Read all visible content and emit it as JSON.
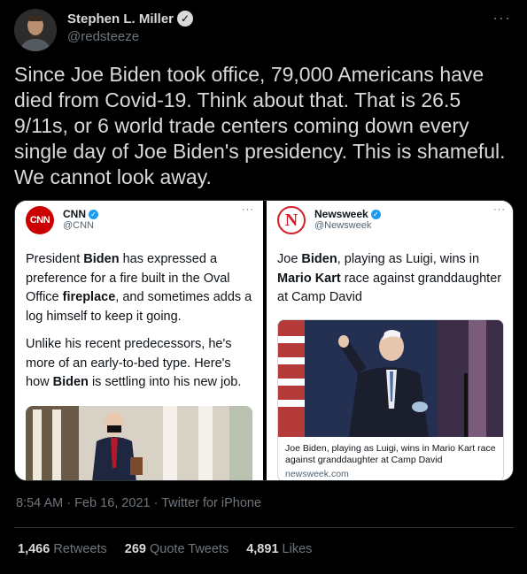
{
  "author": {
    "name": "Stephen L. Miller",
    "handle": "@redsteeze"
  },
  "tweet": {
    "text": "Since Joe Biden took office, 79,000 Americans have died from Covid-19. Think about that. That is 26.5 9/11s, or 6 world trade centers coming down every single day of Joe Biden's presidency. This is shameful. We cannot look away."
  },
  "left_card": {
    "logo_text": "CNN",
    "source_name": "CNN",
    "source_handle": "@CNN",
    "para1": [
      {
        "t": "President ",
        "b": false
      },
      {
        "t": "Biden",
        "b": true
      },
      {
        "t": " has expressed a preference for a fire built in the Oval Office ",
        "b": false
      },
      {
        "t": "fireplace",
        "b": true
      },
      {
        "t": ", and sometimes adds a log himself to keep it going.",
        "b": false
      }
    ],
    "para2": [
      {
        "t": "Unlike his recent predecessors, he's more of an early-to-bed type. Here's how ",
        "b": false
      },
      {
        "t": "Biden",
        "b": true
      },
      {
        "t": " is settling into his new job.",
        "b": false
      }
    ]
  },
  "right_card": {
    "logo_text": "N",
    "source_name": "Newsweek",
    "source_handle": "@Newsweek",
    "body": [
      {
        "t": "Joe ",
        "b": false
      },
      {
        "t": "Biden",
        "b": true
      },
      {
        "t": ", playing as Luigi, wins in ",
        "b": false
      },
      {
        "t": "Mario Kart",
        "b": true
      },
      {
        "t": " race against granddaughter at Camp David",
        "b": false
      }
    ],
    "link_caption": "Joe Biden, playing as Luigi, wins in Mario Kart race against granddaughter at Camp David",
    "link_domain": "newsweek.com"
  },
  "meta": {
    "time": "8:54 AM",
    "date": "Feb 16, 2021",
    "client": "Twitter for iPhone",
    "dot": "·"
  },
  "stats": {
    "retweets_count": "1,466",
    "retweets_label": "Retweets",
    "quotes_count": "269",
    "quotes_label": "Quote Tweets",
    "likes_count": "4,891",
    "likes_label": "Likes"
  },
  "icons": {
    "verified": "verified-badge-icon",
    "more": "more-horizontal-icon"
  },
  "colors": {
    "background": "#000000",
    "text": "#d9d9d9",
    "muted": "#6e767d",
    "cnn_red": "#cc0000",
    "newsweek_red": "#d5202a",
    "verified_blue": "#1d9bf0"
  }
}
